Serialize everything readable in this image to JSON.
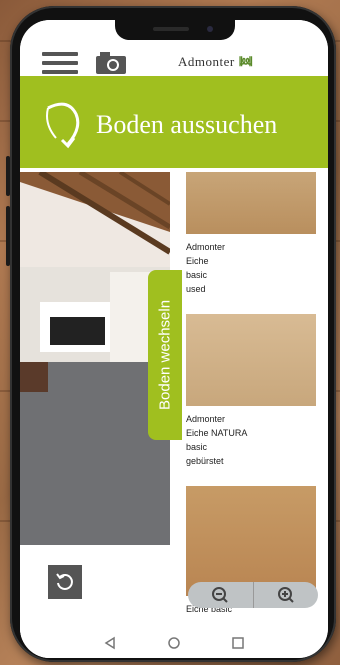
{
  "header": {
    "brand_text": "Admonter",
    "brand_mark": "ꔞ",
    "menu_icon": "hamburger-icon",
    "camera_icon": "camera-icon"
  },
  "banner": {
    "title": "Boden aussuchen",
    "color": "#a0bf1f",
    "arrow_icon": "curved-arrow-icon"
  },
  "side_tab": {
    "label": "Boden wechseln",
    "color": "#a0bf1f"
  },
  "floors": [
    {
      "lines": [
        "Admonter",
        "Eiche",
        "basic",
        "used"
      ],
      "swatch_color": "#c9a77a"
    },
    {
      "lines": [
        "Admonter",
        "Eiche NATURA",
        "basic",
        "gebürstet"
      ],
      "swatch_color": "#d6b891"
    },
    {
      "lines": [
        "Eiche basic"
      ],
      "swatch_color": "#c79b66"
    }
  ],
  "controls": {
    "reset_icon": "rotate-ccw-icon",
    "zoom_out_icon": "zoom-out-icon",
    "zoom_in_icon": "zoom-in-icon"
  },
  "nav": {
    "back_icon": "triangle-back-icon",
    "home_icon": "circle-home-icon",
    "recents_icon": "square-recents-icon"
  }
}
